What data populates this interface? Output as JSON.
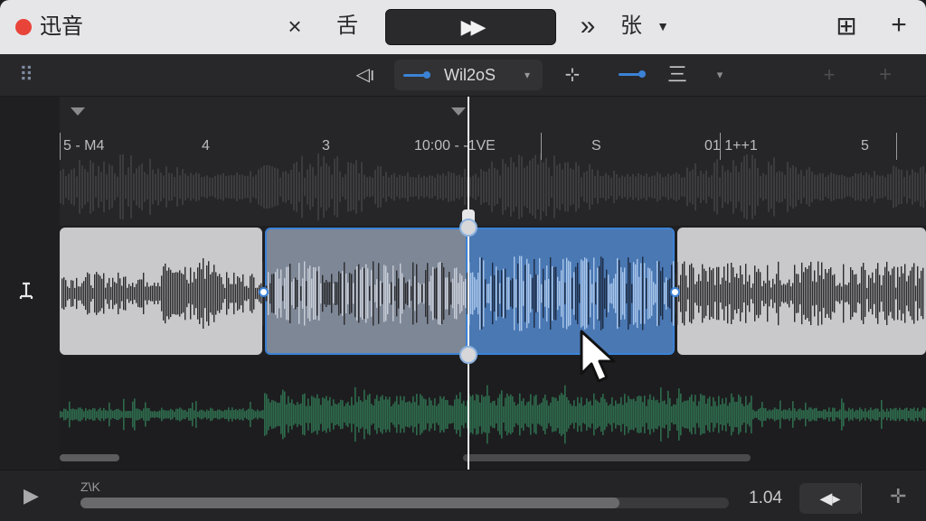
{
  "window": {
    "title": "迅音"
  },
  "titlebar": {
    "cut_icon": "×",
    "label_left": "舌",
    "transport_glyph": "▶▶",
    "skip_glyph": "»",
    "label_right": "张",
    "dropdown_glyph": "▼",
    "add_box_icon": "⊞",
    "plus_icon": "+"
  },
  "toolbar": {
    "grid_icon": "⠿",
    "speaker_icon": "◁ı",
    "tool_label": "Wil2oS",
    "split_icon": "⊹",
    "align_icon": "‡",
    "align_lines": "三",
    "dropdown_glyph": "▾",
    "add_icon_a": "+",
    "add_icon_b": "+"
  },
  "ruler": {
    "labels": [
      "5 - M4",
      "4",
      "3",
      "10:00 - -1VE",
      "S",
      "01 1++1",
      "5"
    ]
  },
  "playhead": {
    "position_label": ""
  },
  "bottom": {
    "play_glyph": "▶",
    "zoom_label": "Z\\K",
    "value": "1.04",
    "volume_glyph": "◀▸",
    "crosshair_glyph": "✛"
  },
  "colors": {
    "selection": "#4a78b3",
    "selection_light": "#5e8fcc",
    "clip": "#c9c9cb",
    "green_wave": "#2e6b4d",
    "close": "#e9443a"
  }
}
